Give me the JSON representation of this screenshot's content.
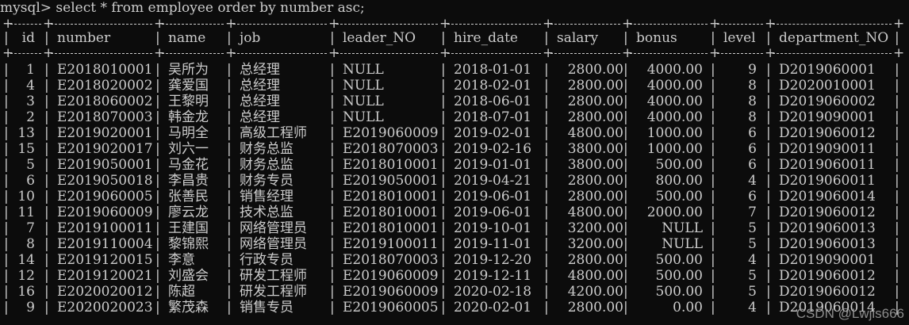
{
  "terminal": {
    "command_line": "mysql> select * from employee order by number asc;",
    "columns": [
      "id",
      "number",
      "name",
      "job",
      "leader_NO",
      "hire_date",
      "salary",
      "bonus",
      "level",
      "department_NO"
    ],
    "rows": [
      [
        "1",
        "E2018010001",
        "吴所为",
        "总经理",
        "NULL",
        "2018-01-01",
        "2800.00",
        "4000.00",
        "9",
        "D2019060001"
      ],
      [
        "4",
        "E2018020002",
        "龚爱国",
        "总经理",
        "NULL",
        "2018-02-01",
        "2800.00",
        "4000.00",
        "8",
        "D2020010001"
      ],
      [
        "3",
        "E2018060002",
        "王黎明",
        "总经理",
        "NULL",
        "2018-06-01",
        "2800.00",
        "4000.00",
        "8",
        "D2019060002"
      ],
      [
        "2",
        "E2018070003",
        "韩金龙",
        "总经理",
        "NULL",
        "2018-07-01",
        "2800.00",
        "4000.00",
        "8",
        "D2019090001"
      ],
      [
        "13",
        "E2019020001",
        "马明全",
        "高级工程师",
        "E2019060009",
        "2019-02-01",
        "4800.00",
        "1000.00",
        "6",
        "D2019060012"
      ],
      [
        "15",
        "E2019020017",
        "刘六一",
        "财务总监",
        "E2018070003",
        "2019-02-16",
        "3800.00",
        "1000.00",
        "6",
        "D2019090011"
      ],
      [
        "5",
        "E2019050001",
        "马金花",
        "财务总监",
        "E2018010001",
        "2019-01-01",
        "3800.00",
        "500.00",
        "6",
        "D2019060011"
      ],
      [
        "6",
        "E2019050018",
        "李昌贵",
        "财务专员",
        "E2019050001",
        "2019-04-21",
        "2800.00",
        "800.00",
        "4",
        "D2019060011"
      ],
      [
        "10",
        "E2019060005",
        "张善民",
        "销售经理",
        "E2018010001",
        "2019-06-01",
        "2800.00",
        "500.00",
        "6",
        "D2019060014"
      ],
      [
        "11",
        "E2019060009",
        "廖云龙",
        "技术总监",
        "E2018010001",
        "2019-06-01",
        "4800.00",
        "2000.00",
        "7",
        "D2019060012"
      ],
      [
        "7",
        "E2019100011",
        "王建国",
        "网络管理员",
        "E2018010001",
        "2019-10-01",
        "3200.00",
        "NULL",
        "5",
        "D2019060013"
      ],
      [
        "8",
        "E2019110004",
        "黎锦熙",
        "网络管理员",
        "E2019100011",
        "2019-11-01",
        "3200.00",
        "NULL",
        "5",
        "D2019060013"
      ],
      [
        "14",
        "E2019120015",
        "李意",
        "行政专员",
        "E2018070003",
        "2019-12-20",
        "2800.00",
        "500.00",
        "4",
        "D2019090001"
      ],
      [
        "12",
        "E2019120021",
        "刘盛会",
        "研发工程师",
        "E2019060009",
        "2019-12-11",
        "4800.00",
        "500.00",
        "5",
        "D2019060012"
      ],
      [
        "16",
        "E2020020012",
        "陈超",
        "研发工程师",
        "E2019060009",
        "2020-02-18",
        "4200.00",
        "500.00",
        "5",
        "D2019060012"
      ],
      [
        "9",
        "E2020020023",
        "繁茂森",
        "销售专员",
        "E2019060005",
        "2020-02-01",
        "2800.00",
        "0.00",
        "4",
        "D2019060014"
      ]
    ],
    "watermark": "CSDN @Lwjls666"
  }
}
